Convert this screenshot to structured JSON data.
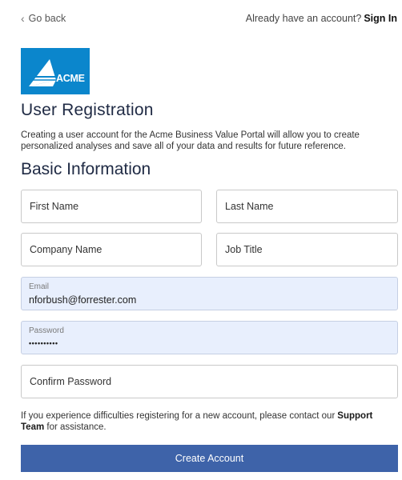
{
  "nav": {
    "back_label": "Go back",
    "account_prompt": "Already have an account?",
    "signin_label": "Sign In"
  },
  "logo": {
    "text": "ACME",
    "color": "#0b86cc"
  },
  "page": {
    "title": "User Registration",
    "intro": "Creating a user account for the Acme Business Value Portal will allow you to create personalized analyses and save all of your data and results for future reference.",
    "section_title": "Basic Information"
  },
  "form": {
    "first_name": {
      "placeholder": "First Name",
      "value": ""
    },
    "last_name": {
      "placeholder": "Last Name",
      "value": ""
    },
    "company_name": {
      "placeholder": "Company Name",
      "value": ""
    },
    "job_title": {
      "placeholder": "Job Title",
      "value": ""
    },
    "email": {
      "label": "Email",
      "value": "nforbush@forrester.com"
    },
    "password": {
      "label": "Password",
      "value": "••••••••••"
    },
    "confirm_password": {
      "placeholder": "Confirm Password",
      "value": ""
    }
  },
  "help": {
    "text": "If you experience difficulties registering for a new account, please contact our",
    "link_label": "Support Team",
    "suffix": "for assistance."
  },
  "actions": {
    "create_label": "Create Account",
    "button_color": "#3e63a9"
  }
}
